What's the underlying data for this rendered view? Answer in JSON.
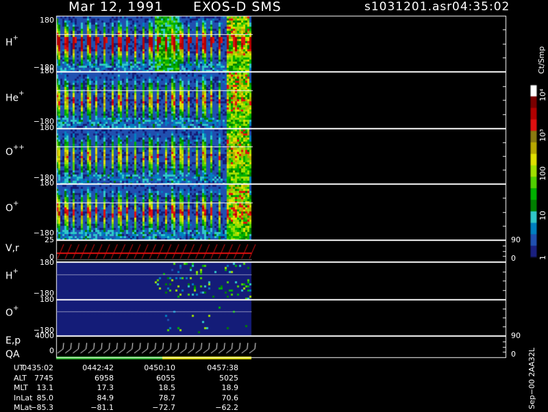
{
  "header": {
    "date": "Mar 12, 1991",
    "mission": "EXOS-D SMS",
    "file": "s1031201.asr",
    "time": "04:35:02"
  },
  "panels": [
    {
      "label": "H",
      "charge": "+",
      "ytop": "180",
      "ybot": "−180"
    },
    {
      "label": "He",
      "charge": "+",
      "ytop": "180",
      "ybot": "−180"
    },
    {
      "label": "O",
      "charge": "++",
      "ytop": "180",
      "ybot": "−180"
    },
    {
      "label": "O",
      "charge": "+",
      "ytop": "180",
      "ybot": "−180"
    },
    {
      "label": "V,r",
      "charge": "",
      "ytop": "25",
      "ybot": "0",
      "rtop": "90",
      "rbot": "0"
    },
    {
      "label": "H",
      "charge": "+",
      "ytop": "180",
      "ybot": "−180"
    },
    {
      "label": "O",
      "charge": "+",
      "ytop": "180",
      "ybot": "−180"
    },
    {
      "label": "E,p",
      "charge": "",
      "ytop": "4000",
      "ybot": "0",
      "rtop": "90",
      "rbot": "0"
    }
  ],
  "qa_label": "QA",
  "colorbar": {
    "unit": "Ct/Smp",
    "ticks": [
      "10⁴",
      "10³",
      "100",
      "10",
      "1"
    ],
    "colors": [
      "#ffffff",
      "#7a0000",
      "#b20000",
      "#e01010",
      "#8a7a10",
      "#b8a800",
      "#e0e000",
      "#a0e000",
      "#50d000",
      "#00b000",
      "#008000",
      "#30c8c8",
      "#0080c0",
      "#2050b0",
      "#1a2080"
    ]
  },
  "footer": {
    "row_labels": [
      "UT",
      "ALT",
      "MLT",
      "InLat",
      "MLat"
    ],
    "columns": [
      {
        "UT": "0435:02",
        "ALT": "7745",
        "MLT": "13.1",
        "InLat": "85.0",
        "MLat": "−85.3"
      },
      {
        "UT": "0442:42",
        "ALT": "6958",
        "MLT": "17.3",
        "InLat": "84.9",
        "MLat": "−81.1"
      },
      {
        "UT": "0450:10",
        "ALT": "6055",
        "MLT": "18.5",
        "InLat": "78.7",
        "MLat": "−72.7"
      },
      {
        "UT": "0457:38",
        "ALT": "5025",
        "MLT": "18.9",
        "InLat": "70.6",
        "MLat": "−62.2"
      }
    ],
    "side_stamp": "Sep−00 2AA32L"
  },
  "chart_data": {
    "type": "heatmap",
    "title": "Mar 12, 1991   EXOS-D SMS",
    "panels": [
      "H+",
      "He+",
      "O++",
      "O+",
      "V,r",
      "H+",
      "O+",
      "E,p"
    ],
    "ylim_angle": [
      -180,
      180
    ],
    "ylim_vr": [
      0,
      25
    ],
    "ylim_ep": [
      0,
      4000
    ],
    "right_axis_vr": [
      0,
      90
    ],
    "right_axis_ep": [
      0,
      90
    ],
    "colorbar_scale": "log",
    "colorbar_range": [
      1,
      10000
    ],
    "x_ticks_ut": [
      "0435:02",
      "0442:42",
      "0450:10",
      "0457:38"
    ]
  }
}
